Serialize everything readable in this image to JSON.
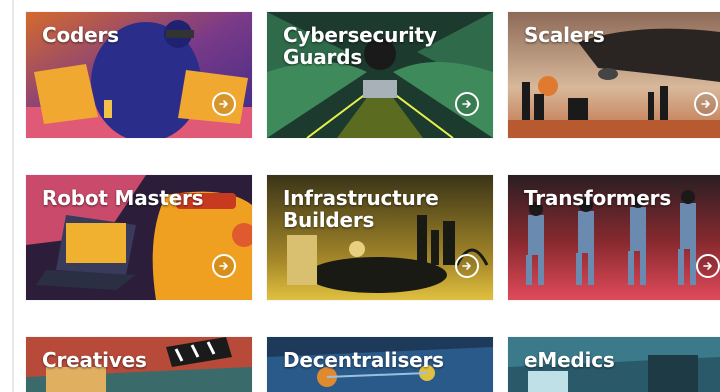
{
  "cards": [
    {
      "title": "Coders",
      "icon": "arrow-right-icon"
    },
    {
      "title": "Cybersecurity\nGuards",
      "icon": "arrow-right-icon"
    },
    {
      "title": "Scalers",
      "icon": "arrow-right-icon"
    },
    {
      "title": "Robot Masters",
      "icon": "arrow-right-icon"
    },
    {
      "title": "Infrastructure\nBuilders",
      "icon": "arrow-right-icon"
    },
    {
      "title": "Transformers",
      "icon": "arrow-right-icon"
    },
    {
      "title": "Creatives",
      "icon": "arrow-right-icon"
    },
    {
      "title": "Decentralisers",
      "icon": "arrow-right-icon"
    },
    {
      "title": "eMedics",
      "icon": "arrow-right-icon"
    }
  ]
}
